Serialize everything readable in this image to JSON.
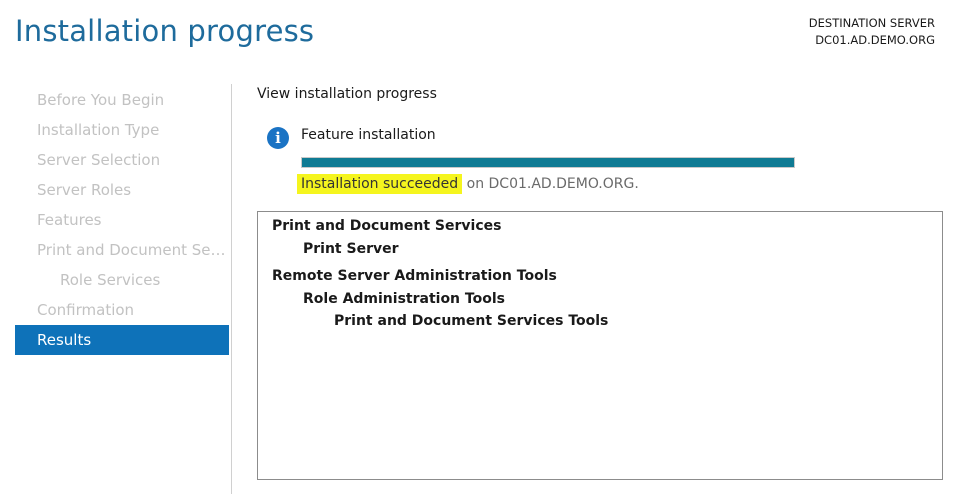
{
  "header": {
    "title": "Installation progress",
    "destination_label": "DESTINATION SERVER",
    "destination_server": "DC01.AD.DEMO.ORG"
  },
  "sidebar": {
    "items": [
      {
        "label": "Before You Begin",
        "state": "disabled"
      },
      {
        "label": "Installation Type",
        "state": "disabled"
      },
      {
        "label": "Server Selection",
        "state": "disabled"
      },
      {
        "label": "Server Roles",
        "state": "disabled"
      },
      {
        "label": "Features",
        "state": "disabled"
      },
      {
        "label": "Print and Document Servi...",
        "state": "disabled"
      },
      {
        "label": "Role Services",
        "state": "disabled",
        "sub": true
      },
      {
        "label": "Confirmation",
        "state": "disabled"
      },
      {
        "label": "Results",
        "state": "active"
      }
    ]
  },
  "main": {
    "subtitle": "View installation progress",
    "feature_label": "Feature installation",
    "progress_percent": 100,
    "status_highlight": "Installation succeeded",
    "status_rest": " on DC01.AD.DEMO.ORG.",
    "results": [
      {
        "text": "Print and Document Services",
        "level": 0
      },
      {
        "text": "Print Server",
        "level": 1
      },
      {
        "text": "Remote Server Administration Tools",
        "level": 0
      },
      {
        "text": "Role Administration Tools",
        "level": 1
      },
      {
        "text": "Print and Document Services Tools",
        "level": 2
      }
    ]
  },
  "colors": {
    "accent": "#0e72b9",
    "title": "#1e6b9c",
    "progress": "#0f7b94",
    "highlight": "#f5f51e"
  }
}
